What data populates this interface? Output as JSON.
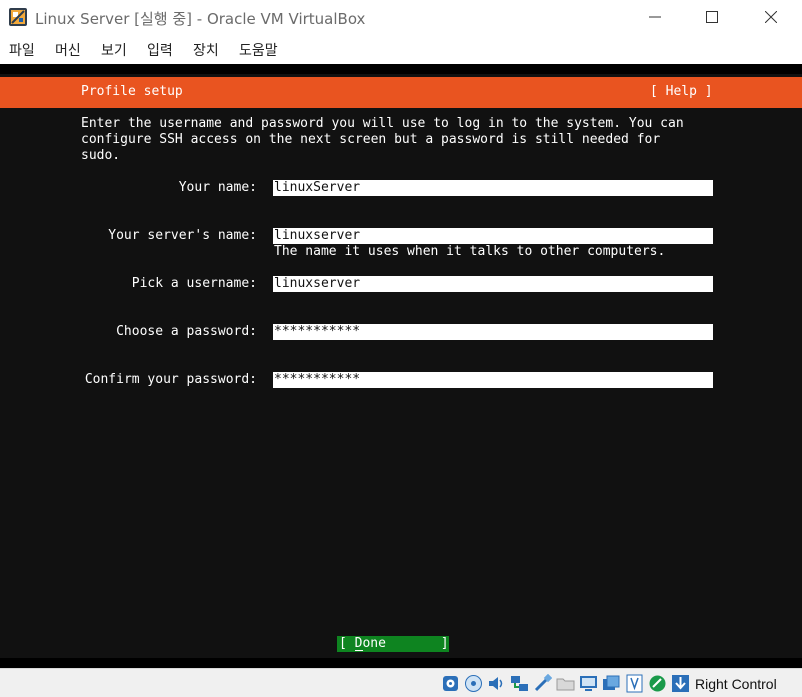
{
  "window": {
    "title": "Linux Server [실행 중] - Oracle VM VirtualBox",
    "icon": "virtualbox-icon"
  },
  "menu": {
    "items": [
      "파일",
      "머신",
      "보기",
      "입력",
      "장치",
      "도움말"
    ]
  },
  "installer": {
    "header_title": "Profile setup",
    "help_label": "[ Help ]",
    "intro_lines": [
      "Enter the username and password you will use to log in to the system. You can",
      "configure SSH access on the next screen but a password is still needed for",
      "sudo."
    ],
    "fields": {
      "your_name": {
        "label": "Your name:",
        "value": "linuxServer"
      },
      "server_name": {
        "label": "Your server's name:",
        "value": "linuxserver",
        "hint": "The name it uses when it talks to other computers."
      },
      "username": {
        "label": "Pick a username:",
        "value": "linuxserver"
      },
      "password": {
        "label": "Choose a password:",
        "value": "***********"
      },
      "confirm_password": {
        "label": "Confirm your password:",
        "value": "***********"
      }
    },
    "done_label": "[ Done       ]"
  },
  "statusbar": {
    "icons": [
      "hard-disk-icon",
      "optical-drive-icon",
      "audio-icon",
      "network-icon",
      "usb-icon",
      "shared-folders-icon",
      "display-icon",
      "video-capture-icon",
      "cpu-virtualization-icon",
      "mouse-integration-icon",
      "keyboard-capture-icon"
    ],
    "host_key_label": "Right Control"
  },
  "colors": {
    "header_orange": "#e95420",
    "done_green": "#0e8420",
    "console_bg": "#111111"
  }
}
